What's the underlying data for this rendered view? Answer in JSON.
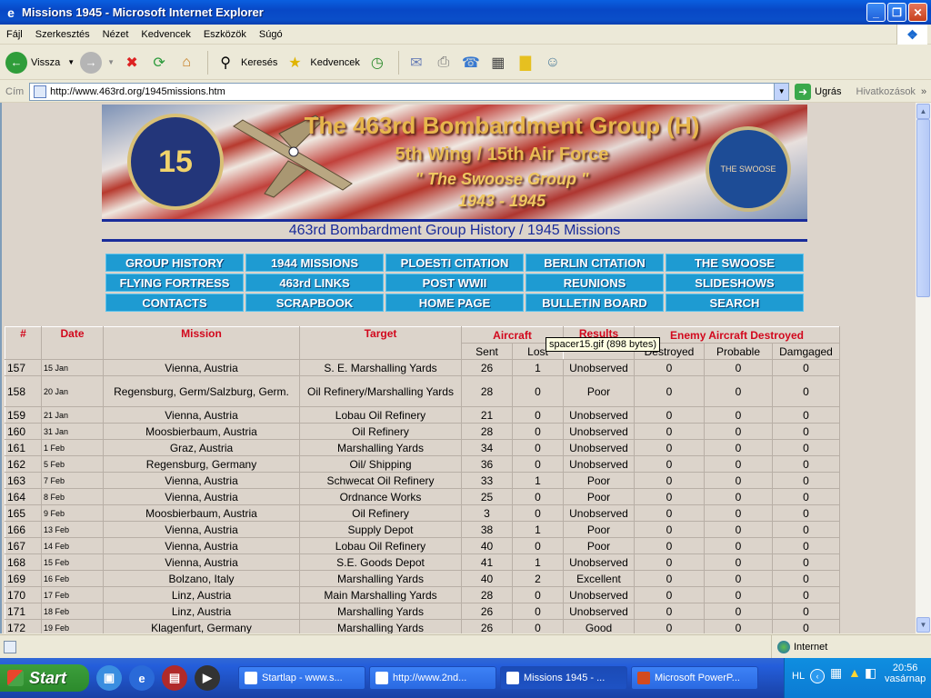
{
  "window": {
    "title": "Missions 1945 - Microsoft Internet Explorer"
  },
  "menu": [
    "Fájl",
    "Szerkesztés",
    "Nézet",
    "Kedvencek",
    "Eszközök",
    "Súgó"
  ],
  "toolbar": {
    "back": "Vissza",
    "search": "Keresés",
    "favorites": "Kedvencek"
  },
  "address": {
    "label": "Cím",
    "url": "http://www.463rd.org/1945missions.htm",
    "go": "Ugrás",
    "links": "Hivatkozások"
  },
  "banner": {
    "title": "The 463rd Bombardment Group (H)",
    "subtitle": "5th Wing  /  15th Air Force",
    "nickname": "\" The Swoose Group \"",
    "years": "1943 - 1945",
    "seal_left": "15",
    "seal_right": "THE SWOOSE"
  },
  "page_heading": "463rd Bombardment Group History / 1945 Missions",
  "nav": [
    "GROUP HISTORY",
    "1944 MISSIONS",
    "PLOESTI CITATION",
    "BERLIN CITATION",
    "THE SWOOSE",
    "FLYING FORTRESS",
    "463rd LINKS",
    "POST WWII",
    "REUNIONS",
    "SLIDESHOWS",
    "CONTACTS",
    "SCRAPBOOK",
    "HOME PAGE",
    "BULLETIN BOARD",
    "SEARCH"
  ],
  "table": {
    "headers": {
      "num": "#",
      "date": "Date",
      "mission": "Mission",
      "target": "Target",
      "aircraft": "Aircraft",
      "results": "Results",
      "enemy": "Enemy Aircraft Destroyed"
    },
    "subheaders": {
      "sent": "Sent",
      "lost": "Lost",
      "destroyed": "Destroyed",
      "probable": "Probable",
      "damaged": "Damgaged"
    },
    "rows": [
      [
        "157",
        "15 Jan",
        "Vienna, Austria",
        "S. E. Marshalling Yards",
        "26",
        "1",
        "Unobserved",
        "0",
        "0",
        "0"
      ],
      [
        "158",
        "20 Jan",
        "Regensburg, Germ/Salzburg, Germ.",
        "Oil Refinery/Marshalling Yards",
        "28",
        "0",
        "Poor",
        "0",
        "0",
        "0"
      ],
      [
        "159",
        "21 Jan",
        "Vienna, Austria",
        "Lobau Oil Refinery",
        "21",
        "0",
        "Unobserved",
        "0",
        "0",
        "0"
      ],
      [
        "160",
        "31 Jan",
        "Moosbierbaum, Austria",
        "Oil Refinery",
        "28",
        "0",
        "Unobserved",
        "0",
        "0",
        "0"
      ],
      [
        "161",
        "1 Feb",
        "Graz, Austria",
        "Marshalling Yards",
        "34",
        "0",
        "Unobserved",
        "0",
        "0",
        "0"
      ],
      [
        "162",
        "5 Feb",
        "Regensburg, Germany",
        "Oil/ Shipping",
        "36",
        "0",
        "Unobserved",
        "0",
        "0",
        "0"
      ],
      [
        "163",
        "7 Feb",
        "Vienna, Austria",
        "Schwecat Oil Refinery",
        "33",
        "1",
        "Poor",
        "0",
        "0",
        "0"
      ],
      [
        "164",
        "8 Feb",
        "Vienna, Austria",
        "Ordnance Works",
        "25",
        "0",
        "Poor",
        "0",
        "0",
        "0"
      ],
      [
        "165",
        "9 Feb",
        "Moosbierbaum, Austria",
        "Oil Refinery",
        "3",
        "0",
        "Unobserved",
        "0",
        "0",
        "0"
      ],
      [
        "166",
        "13 Feb",
        "Vienna, Austria",
        "Supply Depot",
        "38",
        "1",
        "Poor",
        "0",
        "0",
        "0"
      ],
      [
        "167",
        "14 Feb",
        "Vienna, Austria",
        "Lobau Oil Refinery",
        "40",
        "0",
        "Poor",
        "0",
        "0",
        "0"
      ],
      [
        "168",
        "15 Feb",
        "Vienna, Austria",
        "S.E. Goods Depot",
        "41",
        "1",
        "Unobserved",
        "0",
        "0",
        "0"
      ],
      [
        "169",
        "16 Feb",
        "Bolzano, Italy",
        "Marshalling Yards",
        "40",
        "2",
        "Excellent",
        "0",
        "0",
        "0"
      ],
      [
        "170",
        "17 Feb",
        "Linz, Austria",
        "Main Marshalling Yards",
        "28",
        "0",
        "Unobserved",
        "0",
        "0",
        "0"
      ],
      [
        "171",
        "18 Feb",
        "Linz, Austria",
        "Marshalling Yards",
        "26",
        "0",
        "Unobserved",
        "0",
        "0",
        "0"
      ],
      [
        "172",
        "19 Feb",
        "Klagenfurt, Germany",
        "Marshalling Yards",
        "26",
        "0",
        "Good",
        "0",
        "0",
        "0"
      ]
    ]
  },
  "tooltip": "spacer15.gif (898 bytes)",
  "status": {
    "zone": "Internet"
  },
  "taskbar": {
    "start": "Start",
    "tasks": [
      "Startlap - www.s...",
      "http://www.2nd...",
      "Missions 1945 - ...",
      "Microsoft PowerP..."
    ],
    "lang": "HL",
    "time": "20:56",
    "day": "vasárnap"
  },
  "colors": {
    "nav_button": "#1e9bd2",
    "header_red": "#d2081d",
    "heading_blue": "#1a2c9a",
    "page_bg": "#dcd4cb"
  }
}
